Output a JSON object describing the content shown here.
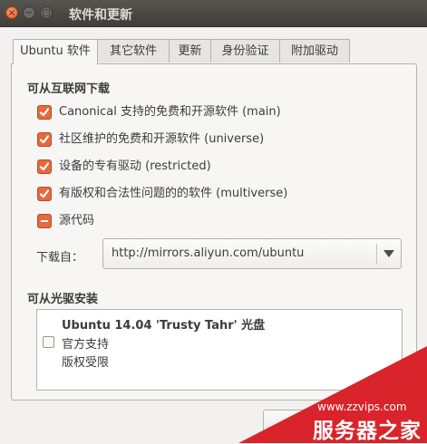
{
  "window": {
    "title": "软件和更新",
    "close_symbol": "×",
    "min_symbol": "−",
    "max_symbol": "□"
  },
  "tabs": [
    {
      "label": "Ubuntu 软件",
      "active": true
    },
    {
      "label": "其它软件",
      "active": false
    },
    {
      "label": "更新",
      "active": false
    },
    {
      "label": "身份验证",
      "active": false
    },
    {
      "label": "附加驱动",
      "active": false
    }
  ],
  "internet": {
    "title": "可从互联网下载",
    "items": [
      {
        "label": "Canonical 支持的免费和开源软件 (main)",
        "state": "checked"
      },
      {
        "label": "社区维护的免费和开源软件 (universe)",
        "state": "checked"
      },
      {
        "label": "设备的专有驱动 (restricted)",
        "state": "checked"
      },
      {
        "label": "有版权和合法性问题的的软件 (multiverse)",
        "state": "checked"
      },
      {
        "label": "源代码",
        "state": "mixed"
      }
    ],
    "download_from_label": "下载自：",
    "download_from_value": "http://mirrors.aliyun.com/ubuntu"
  },
  "cdrom": {
    "title": "可从光驱安装",
    "disc_name": "Ubuntu 14.04 'Trusty Tahr' 光盘",
    "lines": [
      "官方支持",
      "版权受限"
    ],
    "checked": false
  },
  "watermark": {
    "url": "www.zzvips.com",
    "name": "服务器之家",
    "color": "#d8242a"
  },
  "colors": {
    "accent": "#e6683c",
    "titlebar": "#3f3e3a",
    "background": "#f2f1f0"
  }
}
